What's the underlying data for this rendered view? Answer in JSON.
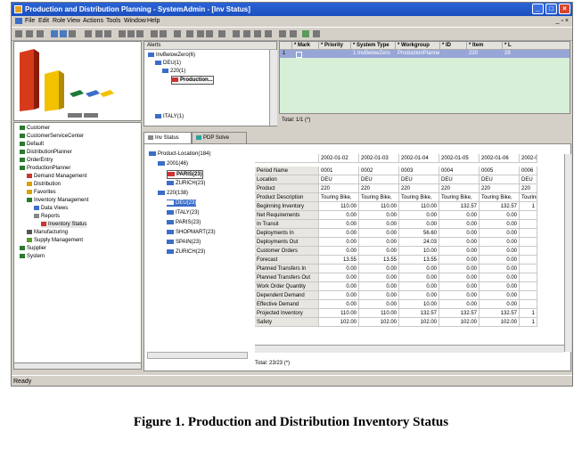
{
  "window": {
    "title": "Production and Distribution Planning - SystemAdmin - [Inv Status]",
    "min": "_",
    "max": "□",
    "close": "×"
  },
  "menu": [
    "File",
    "Edit",
    "Role",
    "View",
    "Actions",
    "Tools",
    "Window",
    "Help"
  ],
  "mdi_controls": "_ ▫ ×",
  "nav": [
    {
      "label": "Customer",
      "level": 0
    },
    {
      "label": "CustomerServiceCenter",
      "level": 0
    },
    {
      "label": "Default",
      "level": 0
    },
    {
      "label": "DistributionPlanner",
      "level": 0
    },
    {
      "label": "OrderEntry",
      "level": 0
    },
    {
      "label": "ProductionPlanner",
      "level": 0
    },
    {
      "label": "Demand Management",
      "level": 1
    },
    {
      "label": "Distribution",
      "level": 1
    },
    {
      "label": "Favorites",
      "level": 1
    },
    {
      "label": "Inventory Management",
      "level": 1
    },
    {
      "label": "Data Views",
      "level": 2
    },
    {
      "label": "Reports",
      "level": 2
    },
    {
      "label": "Inventory Status",
      "level": 3
    },
    {
      "label": "Manufacturing",
      "level": 1
    },
    {
      "label": "Supply Management",
      "level": 1
    },
    {
      "label": "Supplier",
      "level": 0
    },
    {
      "label": "System",
      "level": 0
    }
  ],
  "alerts": {
    "header": "Alerts",
    "items": [
      {
        "label": "InvBelowZero(6)",
        "level": 0
      },
      {
        "label": "DEU(1)",
        "level": 1
      },
      {
        "label": "220(1)",
        "level": 2
      },
      {
        "label": "Production...",
        "level": 3
      },
      {
        "label": "ITALY(1)",
        "level": 1
      }
    ],
    "total": "Total: 1/1 (*)"
  },
  "grid1": {
    "headers": [
      "",
      "* Mark",
      "* Priority",
      "* System Type",
      "* Workgroup",
      "* ID",
      "* Item",
      "* L"
    ],
    "row": [
      "1",
      "",
      "",
      "1 InvBelowZero",
      "ProductionPlanne",
      "",
      "220",
      "28"
    ]
  },
  "tabs": [
    {
      "label": "Inv Status",
      "active": true
    },
    {
      "label": "PDP Solve",
      "active": false
    }
  ],
  "tree2": [
    {
      "label": "Product-Location(184)",
      "level": 0
    },
    {
      "label": "2001(46)",
      "level": 1
    },
    {
      "label": "PARIS(23)",
      "level": 2,
      "style": "bold"
    },
    {
      "label": "ZURICH(23)",
      "level": 2
    },
    {
      "label": "220(138)",
      "level": 1
    },
    {
      "label": "DEU(23)",
      "level": 2,
      "style": "sel"
    },
    {
      "label": "ITALY(23)",
      "level": 2
    },
    {
      "label": "PARIS(23)",
      "level": 2
    },
    {
      "label": "SHOPMART(23)",
      "level": 2
    },
    {
      "label": "SPAIN(23)",
      "level": 2
    },
    {
      "label": "ZURICH(23)",
      "level": 2
    }
  ],
  "tree2_total": "Total: 23/23 (*)",
  "datagrid": {
    "dates": [
      "2002-01-02",
      "2002-01-03",
      "2002-01-04",
      "2002-01-05",
      "2002-01-06",
      "2002-0"
    ],
    "rows": [
      {
        "label": "Period Name",
        "cells": [
          "0001",
          "0002",
          "0003",
          "0004",
          "0005",
          "0006"
        ],
        "num": false
      },
      {
        "label": "Location",
        "cells": [
          "DEU",
          "DEU",
          "DEU",
          "DEU",
          "DEU",
          "DEU"
        ],
        "num": false
      },
      {
        "label": "Product",
        "cells": [
          "220",
          "220",
          "220",
          "220",
          "220",
          "220"
        ],
        "num": false
      },
      {
        "label": "Product Description",
        "cells": [
          "Touring Bike,",
          "Touring Bike,",
          "Touring Bike,",
          "Touring Bike,",
          "Touring Bike,",
          "Touring"
        ],
        "num": false
      },
      {
        "label": "Beginning Inventory",
        "cells": [
          "110.00",
          "110.00",
          "110.00",
          "132.57",
          "132.57",
          "1"
        ],
        "num": true
      },
      {
        "label": "Net Requirements",
        "cells": [
          "0.00",
          "0.00",
          "0.00",
          "0.00",
          "0.00",
          ""
        ],
        "num": true
      },
      {
        "label": "In Transit",
        "cells": [
          "0.00",
          "0.00",
          "0.00",
          "0.00",
          "0.00",
          ""
        ],
        "num": true
      },
      {
        "label": "Deployments In",
        "cells": [
          "0.00",
          "0.00",
          "56.60",
          "0.00",
          "0.00",
          ""
        ],
        "num": true
      },
      {
        "label": "Deployments Out",
        "cells": [
          "0.00",
          "0.00",
          "24.03",
          "0.00",
          "0.00",
          ""
        ],
        "num": true
      },
      {
        "label": "Customer Orders",
        "cells": [
          "0.00",
          "0.00",
          "10.00",
          "0.00",
          "0.00",
          ""
        ],
        "num": true
      },
      {
        "label": "Forecast",
        "cells": [
          "13.55",
          "13.55",
          "13.55",
          "0.00",
          "0.00",
          ""
        ],
        "num": true
      },
      {
        "label": "Planned Transfers In",
        "cells": [
          "0.00",
          "0.00",
          "0.00",
          "0.00",
          "0.00",
          ""
        ],
        "num": true
      },
      {
        "label": "Planned Transfers Out",
        "cells": [
          "0.00",
          "0.00",
          "0.00",
          "0.00",
          "0.00",
          ""
        ],
        "num": true
      },
      {
        "label": "Work Order Quantity",
        "cells": [
          "0.00",
          "0.00",
          "0.00",
          "0.00",
          "0.00",
          ""
        ],
        "num": true
      },
      {
        "label": "Dependent Demand",
        "cells": [
          "0.00",
          "0.00",
          "0.00",
          "0.00",
          "0.00",
          ""
        ],
        "num": true
      },
      {
        "label": "Effective Demand",
        "cells": [
          "0.00",
          "0.00",
          "10.00",
          "0.00",
          "0.00",
          ""
        ],
        "num": true
      },
      {
        "label": "Projected Inventory",
        "cells": [
          "110.00",
          "110.00",
          "132.57",
          "132.57",
          "132.57",
          "1"
        ],
        "num": true
      },
      {
        "label": "Safety",
        "cells": [
          "102.00",
          "102.00",
          "102.00",
          "102.00",
          "102.00",
          "1"
        ],
        "num": true
      }
    ],
    "total": "Total: 23/23 (*)"
  },
  "status": "Ready",
  "caption": "Figure 1.  Production and Distribution Inventory Status",
  "colors": {
    "titlebar": "#1c4fbf",
    "selection": "#3b6dc9",
    "grid_row": "#d7efd7"
  }
}
